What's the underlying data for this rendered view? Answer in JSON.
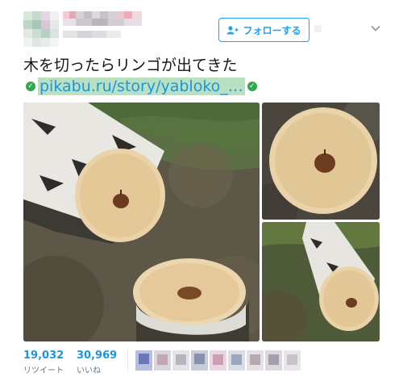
{
  "header": {
    "follow_label": "フォローする"
  },
  "tweet": {
    "text": "木を切ったらリンゴが出てきた",
    "link": "pikabu.ru/story/yabloko_…"
  },
  "stats": {
    "retweets": {
      "count": "19,032",
      "label": "リツイート"
    },
    "likes": {
      "count": "30,969",
      "label": "いいね"
    }
  },
  "colors": {
    "accent": "#1da1f2",
    "link": "#1b95e0",
    "link_highlight": "#b9e0c0"
  },
  "icons": [
    "add-user-icon",
    "chevron-down-icon",
    "verified-link-icon"
  ]
}
